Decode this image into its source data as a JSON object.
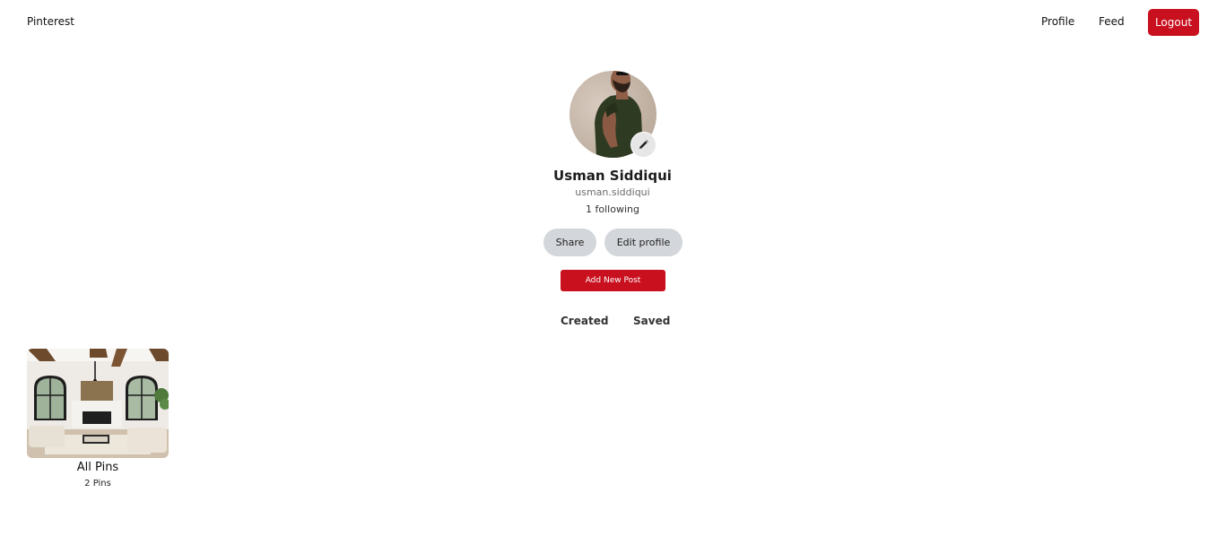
{
  "navbar": {
    "brand": "Pinterest",
    "links": {
      "profile": "Profile",
      "feed": "Feed"
    },
    "logout_label": "Logout",
    "accent_color": "#c8101e"
  },
  "profile": {
    "avatar_icon": "user-avatar-photo",
    "edit_avatar_icon": "pencil-icon",
    "name": "Usman Siddiqui",
    "username": "usman.siddiqui",
    "following": "1 following",
    "buttons": {
      "share": "Share",
      "edit_profile": "Edit profile",
      "add_new_post": "Add New Post"
    }
  },
  "tabs": {
    "created": "Created",
    "saved": "Saved"
  },
  "boards": [
    {
      "title": "All Pins",
      "count": "2 Pins",
      "thumbnail_icon": "living-room-photo"
    }
  ]
}
